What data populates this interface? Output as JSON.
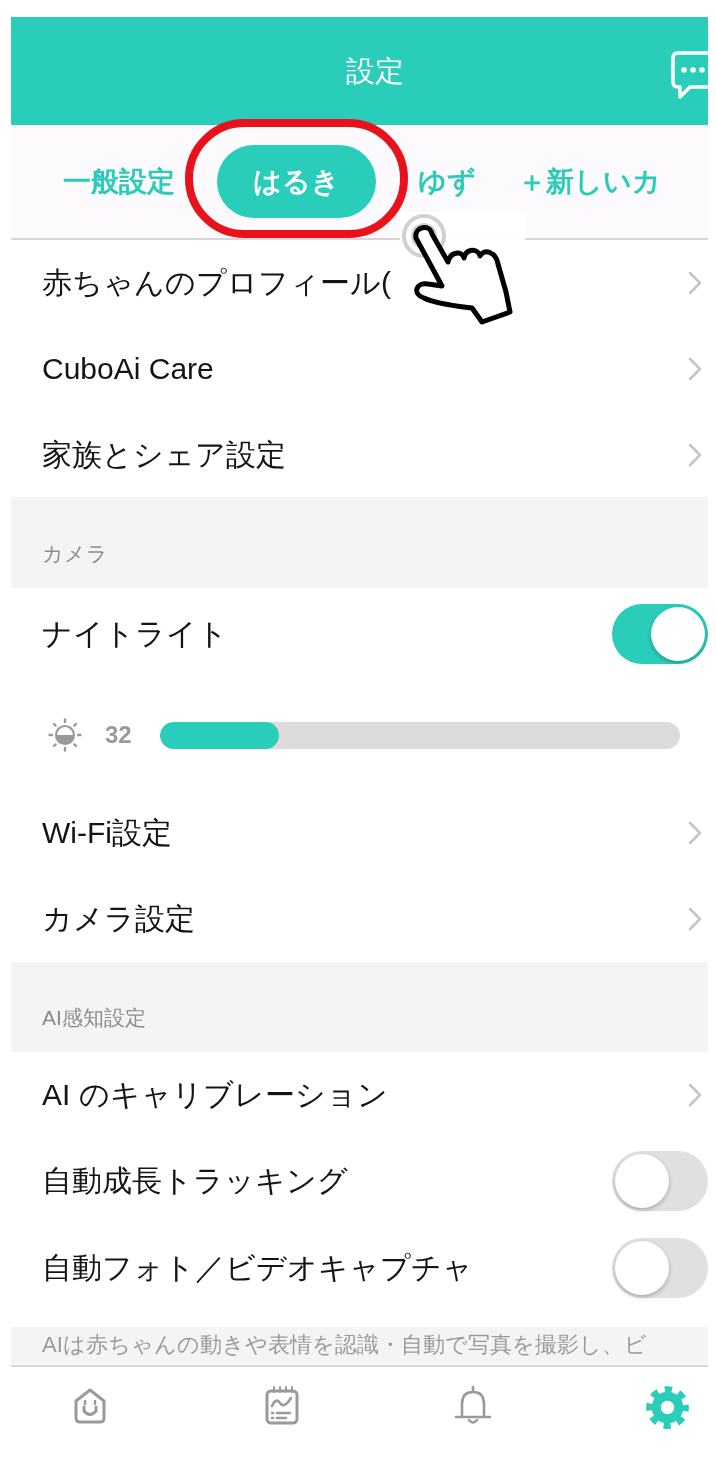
{
  "header": {
    "title": "設定"
  },
  "tabs": [
    {
      "label": "一般設定",
      "selected": false
    },
    {
      "label": "はるき",
      "selected": true
    },
    {
      "label": "ゆず",
      "selected": false
    },
    {
      "label": "＋新しいカ",
      "selected": false
    }
  ],
  "sections": [
    {
      "items": [
        {
          "kind": "link",
          "label": "赤ちゃんのプロフィール("
        },
        {
          "kind": "link",
          "label": "CuboAi Care"
        },
        {
          "kind": "link",
          "label": "家族とシェア設定"
        }
      ]
    },
    {
      "title": "カメラ",
      "items": [
        {
          "kind": "toggle",
          "label": "ナイトライト",
          "on": true
        },
        {
          "kind": "slider",
          "reading": "32",
          "level": 0.23
        },
        {
          "kind": "link",
          "label": "Wi-Fi設定"
        },
        {
          "kind": "link",
          "label": "カメラ設定"
        }
      ]
    },
    {
      "title": "AI感知設定",
      "items": [
        {
          "kind": "link",
          "label": "AI のキャリブレーション"
        },
        {
          "kind": "toggle",
          "label": "自動成長トラッキング",
          "on": false
        },
        {
          "kind": "toggle",
          "label": "自動フォト／ビデオキャプチャ",
          "on": false
        }
      ],
      "note": "AIは赤ちゃんの動きや表情を認識・自動で写真を撮影し、ビ"
    }
  ],
  "bottom_nav": [
    {
      "selected": false
    },
    {
      "selected": false
    },
    {
      "selected": false
    },
    {
      "selected": true
    }
  ]
}
